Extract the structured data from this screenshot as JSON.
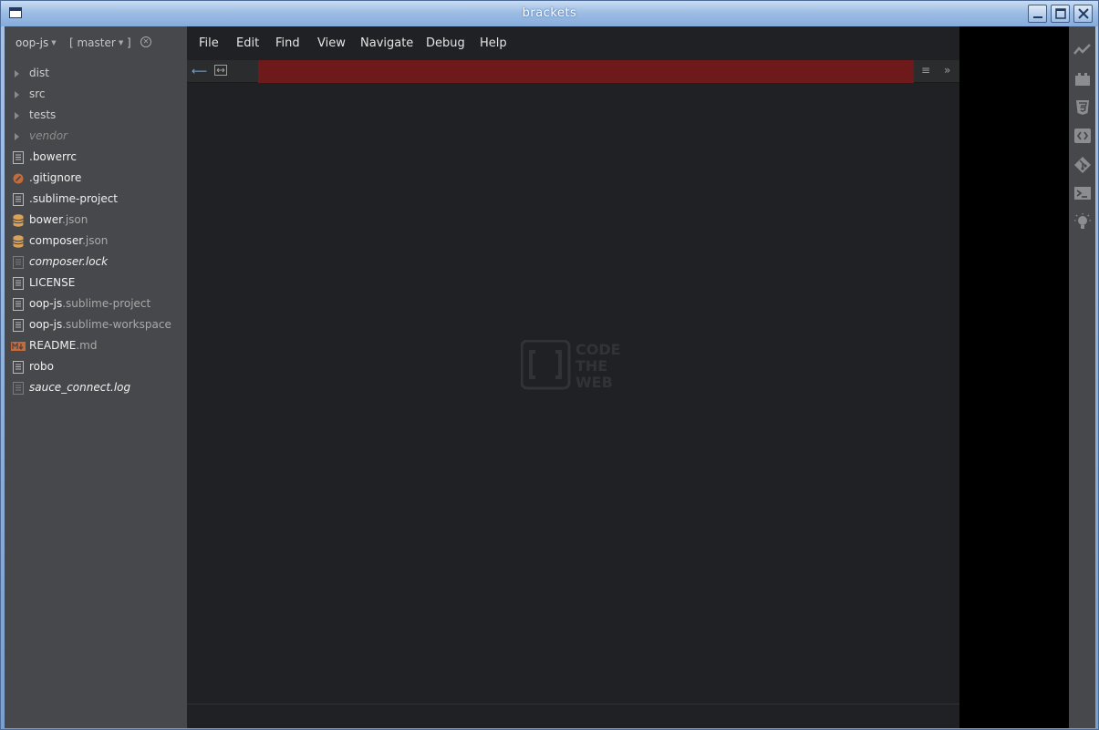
{
  "window": {
    "title": "brackets"
  },
  "sidebar": {
    "project": "oop-js",
    "branch": "[ master",
    "branch_close": "]",
    "items": [
      {
        "type": "folder",
        "name": "dist"
      },
      {
        "type": "folder",
        "name": "src"
      },
      {
        "type": "folder",
        "name": "tests"
      },
      {
        "type": "folder",
        "name": "vendor",
        "dim": true
      },
      {
        "type": "file",
        "icon": "document-icon",
        "name": ".bowerrc",
        "ext": ""
      },
      {
        "type": "file",
        "icon": "git-ignore-icon",
        "name": ".gitignore",
        "ext": ""
      },
      {
        "type": "file",
        "icon": "document-icon",
        "name": ".sublime-project",
        "ext": ""
      },
      {
        "type": "file",
        "icon": "database-icon",
        "name": "bower",
        "ext": ".json"
      },
      {
        "type": "file",
        "icon": "database-icon",
        "name": "composer",
        "ext": ".json"
      },
      {
        "type": "file",
        "icon": "document-icon",
        "name": "composer.lock",
        "ext": "",
        "dim": true
      },
      {
        "type": "file",
        "icon": "document-icon",
        "name": "LICENSE",
        "ext": ""
      },
      {
        "type": "file",
        "icon": "document-icon",
        "name": "oop-js",
        "ext": ".sublime-project"
      },
      {
        "type": "file",
        "icon": "document-icon",
        "name": "oop-js",
        "ext": ".sublime-workspace"
      },
      {
        "type": "file",
        "icon": "markdown-icon",
        "name": "README",
        "ext": ".md"
      },
      {
        "type": "file",
        "icon": "document-icon",
        "name": "robo",
        "ext": ""
      },
      {
        "type": "file",
        "icon": "document-icon",
        "name": "sauce_connect.log",
        "ext": "",
        "dim": true
      }
    ]
  },
  "menu": [
    "File",
    "Edit",
    "Find",
    "View",
    "Navigate",
    "Debug",
    "Help"
  ],
  "toolbar": {
    "back_icon": "arrow-left-icon",
    "split_icon": "split-view-icon",
    "menu_icon": "hamburger-icon",
    "more_icon": "chevron-double-right-icon",
    "bar_color": "#6e1a1a"
  },
  "logo": {
    "line1": "CODE",
    "line2": "THE",
    "line3": "WEB"
  },
  "right_toolbar": [
    "live-preview-icon",
    "extension-manager-icon",
    "css3-icon",
    "code-icon",
    "git-icon",
    "terminal-icon",
    "lightbulb-icon"
  ]
}
